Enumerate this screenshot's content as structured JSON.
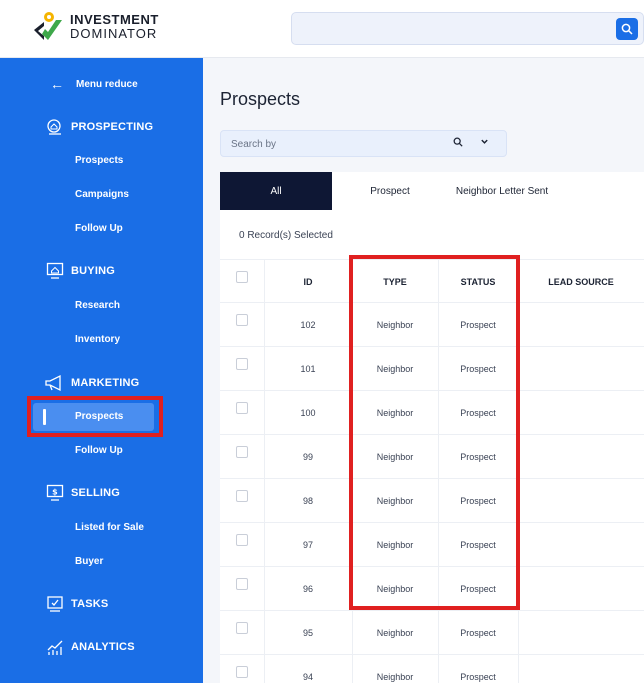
{
  "app": {
    "logo_line1": "INVESTMENT",
    "logo_line2": "DOMINATOR",
    "accent": "#1a6ee6",
    "highlight": "#e02020"
  },
  "topbar": {
    "search_icon": "search-icon"
  },
  "sidebar": {
    "menu_reduce": "Menu reduce",
    "sections": {
      "prospecting": {
        "label": "PROSPECTING",
        "items": [
          "Prospects",
          "Campaigns",
          "Follow Up"
        ]
      },
      "buying": {
        "label": "BUYING",
        "items": [
          "Research",
          "Inventory"
        ]
      },
      "marketing": {
        "label": "MARKETING",
        "items": [
          "Prospects",
          "Follow Up"
        ]
      },
      "selling": {
        "label": "SELLING",
        "items": [
          "Listed for Sale",
          "Buyer"
        ]
      },
      "tasks": {
        "label": "TASKS"
      },
      "analytics": {
        "label": "ANALYTICS"
      }
    }
  },
  "main": {
    "title": "Prospects",
    "search_placeholder": "Search by",
    "tabs": [
      "All",
      "Prospect",
      "Neighbor Letter Sent"
    ],
    "selected_count": "0 Record(s) Selected",
    "columns": [
      "ID",
      "TYPE",
      "STATUS",
      "LEAD SOURCE"
    ],
    "rows": [
      {
        "id": "102",
        "type": "Neighbor",
        "status": "Prospect"
      },
      {
        "id": "101",
        "type": "Neighbor",
        "status": "Prospect"
      },
      {
        "id": "100",
        "type": "Neighbor",
        "status": "Prospect"
      },
      {
        "id": "99",
        "type": "Neighbor",
        "status": "Prospect"
      },
      {
        "id": "98",
        "type": "Neighbor",
        "status": "Prospect"
      },
      {
        "id": "97",
        "type": "Neighbor",
        "status": "Prospect"
      },
      {
        "id": "96",
        "type": "Neighbor",
        "status": "Prospect"
      },
      {
        "id": "95",
        "type": "Neighbor",
        "status": "Prospect"
      },
      {
        "id": "94",
        "type": "Neighbor",
        "status": "Prospect"
      }
    ]
  }
}
